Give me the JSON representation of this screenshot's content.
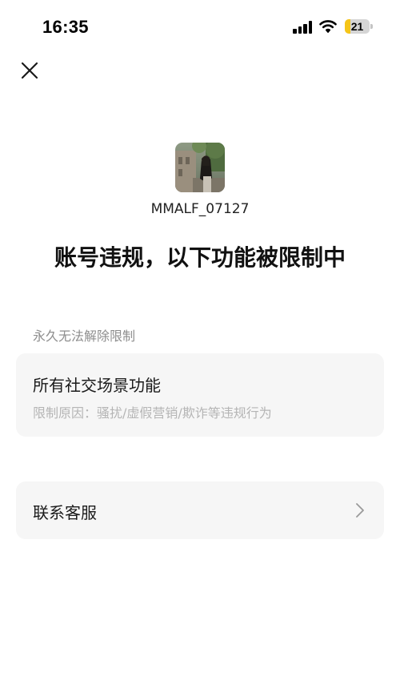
{
  "status_bar": {
    "time": "16:35",
    "battery_level": "21",
    "battery_fraction": 0.21,
    "icons": [
      "signal-icon",
      "wifi-icon",
      "battery-icon"
    ]
  },
  "header": {
    "close_icon": "close-icon"
  },
  "profile": {
    "avatar": "avatar-photo",
    "username": "MMALF_07127"
  },
  "title": "账号违规，以下功能被限制中",
  "restriction": {
    "section_label": "永久无法解除限制",
    "title": "所有社交场景功能",
    "reason": "限制原因：骚扰/虚假营销/欺诈等违规行为"
  },
  "support": {
    "label": "联系客服",
    "icon": "chevron-right-icon"
  },
  "colors": {
    "battery_fill": "#f5c518",
    "card_background": "#f6f6f6",
    "secondary_text": "#8e8e8e"
  }
}
